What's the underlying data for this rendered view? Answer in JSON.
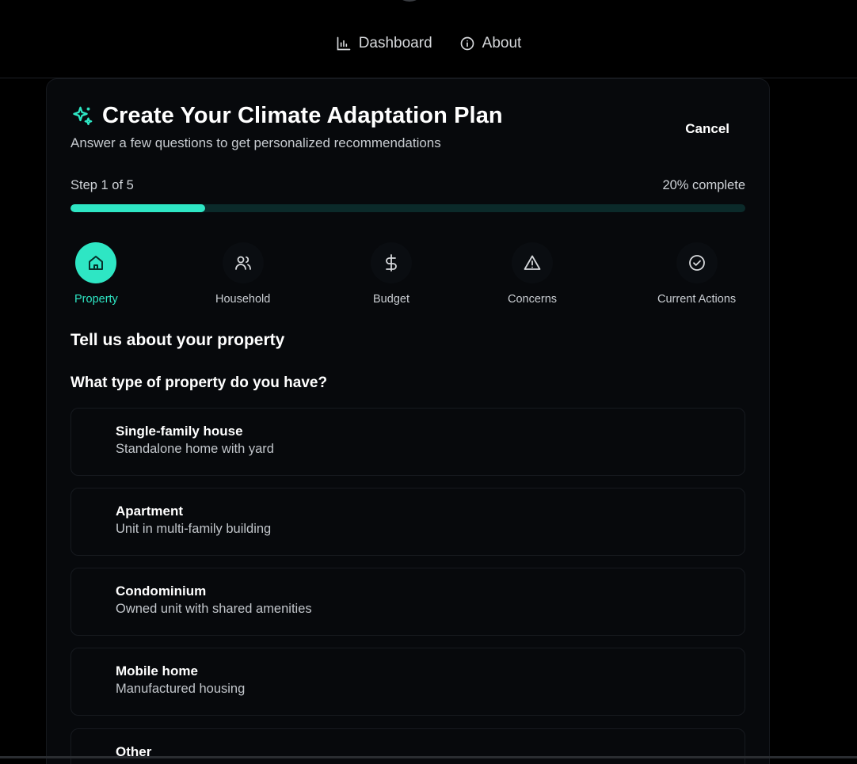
{
  "nav": {
    "dashboard_label": "Dashboard",
    "about_label": "About",
    "dashboard_icon": "bar-chart-icon",
    "about_icon": "info-icon"
  },
  "wizard": {
    "title": "Create Your Climate Adaptation Plan",
    "subtitle": "Answer a few questions to get personalized recommendations",
    "cancel_label": "Cancel",
    "title_icon": "sparkles-icon",
    "accent_color": "#2ee6c4"
  },
  "progress": {
    "step_text": "Step 1 of 5",
    "percent_text": "20% complete",
    "fraction": 0.2
  },
  "steps": [
    {
      "label": "Property",
      "icon": "home-icon",
      "active": true
    },
    {
      "label": "Household",
      "icon": "users-icon",
      "active": false
    },
    {
      "label": "Budget",
      "icon": "dollar-icon",
      "active": false
    },
    {
      "label": "Concerns",
      "icon": "alert-triangle-icon",
      "active": false
    },
    {
      "label": "Current Actions",
      "icon": "check-circle-icon",
      "active": false
    }
  ],
  "form": {
    "section_title": "Tell us about your property",
    "question": "What type of property do you have?",
    "options": [
      {
        "title": "Single-family house",
        "description": "Standalone home with yard"
      },
      {
        "title": "Apartment",
        "description": "Unit in multi-family building"
      },
      {
        "title": "Condominium",
        "description": "Owned unit with shared amenities"
      },
      {
        "title": "Mobile home",
        "description": "Manufactured housing"
      },
      {
        "title": "Other",
        "description": ""
      }
    ]
  }
}
